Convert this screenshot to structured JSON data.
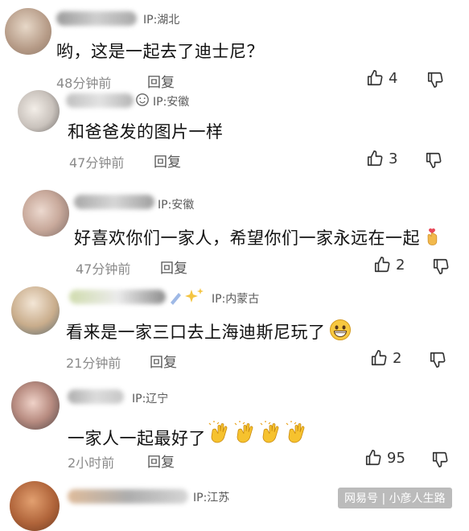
{
  "comments": [
    {
      "ip": "IP:湖北",
      "text": "哟，这是一起去了迪士尼？",
      "time": "48分钟前",
      "reply": "回复",
      "likes": "4"
    },
    {
      "ip": "IP:安徽",
      "text": "和爸爸发的图片一样",
      "time": "47分钟前",
      "reply": "回复",
      "likes": "3"
    },
    {
      "ip": "IP:安徽",
      "text": "好喜欢你们一家人，希望你们一家永远在一起",
      "time": "47分钟前",
      "reply": "回复",
      "likes": "2"
    },
    {
      "ip": "IP:内蒙古",
      "text": "看来是一家三口去上海迪斯尼玩了",
      "time": "21分钟前",
      "reply": "回复",
      "likes": "2"
    },
    {
      "ip": "IP:辽宁",
      "text": "一家人一起最好了",
      "time": "2小时前",
      "reply": "回复",
      "likes": "95"
    },
    {
      "ip": "IP:江苏"
    }
  ],
  "watermark": "网易号 | 小彦人生路",
  "colors": {
    "text": "#111111",
    "meta": "#8a8a8a",
    "ip": "#5a5a5a",
    "background": "#ffffff"
  }
}
